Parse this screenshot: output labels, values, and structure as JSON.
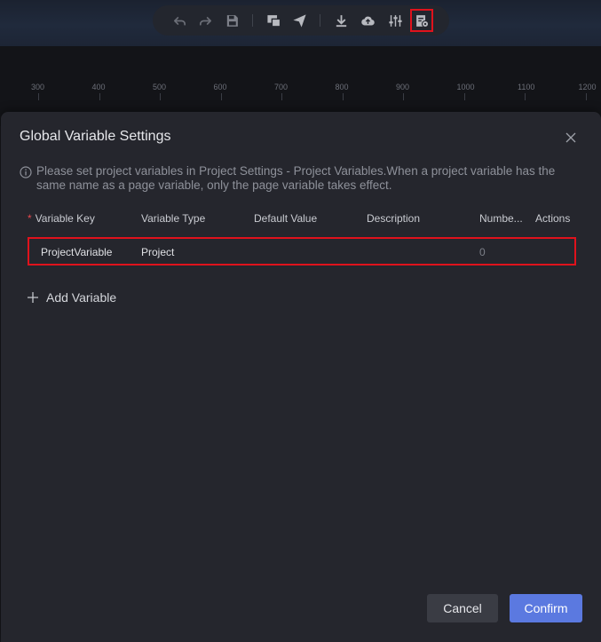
{
  "toolbar": {
    "icons": [
      "undo-icon",
      "redo-icon",
      "save-icon",
      "preview-icon",
      "publish-icon",
      "download-icon",
      "upload-cloud-icon",
      "settings-sliders-icon",
      "global-variables-icon"
    ]
  },
  "ruler": {
    "ticks": [
      "300",
      "400",
      "500",
      "600",
      "700",
      "800",
      "900",
      "1000",
      "1100",
      "1200"
    ]
  },
  "dialog": {
    "title": "Global Variable Settings",
    "info": "Please set project variables in Project Settings - Project Variables.When a project variable has the same name as a page variable, only the page variable takes effect.",
    "columns": {
      "required_mark": "*",
      "key": "Variable Key",
      "type": "Variable Type",
      "default": "Default Value",
      "description": "Description",
      "number": "Numbe...",
      "actions": "Actions"
    },
    "rows": [
      {
        "key": "ProjectVariable",
        "type": "Project",
        "default": "",
        "description": "",
        "number": "0",
        "actions": ""
      }
    ],
    "add_label": "Add Variable",
    "cancel_label": "Cancel",
    "confirm_label": "Confirm"
  },
  "colors": {
    "accent": "#5b79e0",
    "highlight": "#e0121c",
    "dialog_bg": "#25262d"
  }
}
